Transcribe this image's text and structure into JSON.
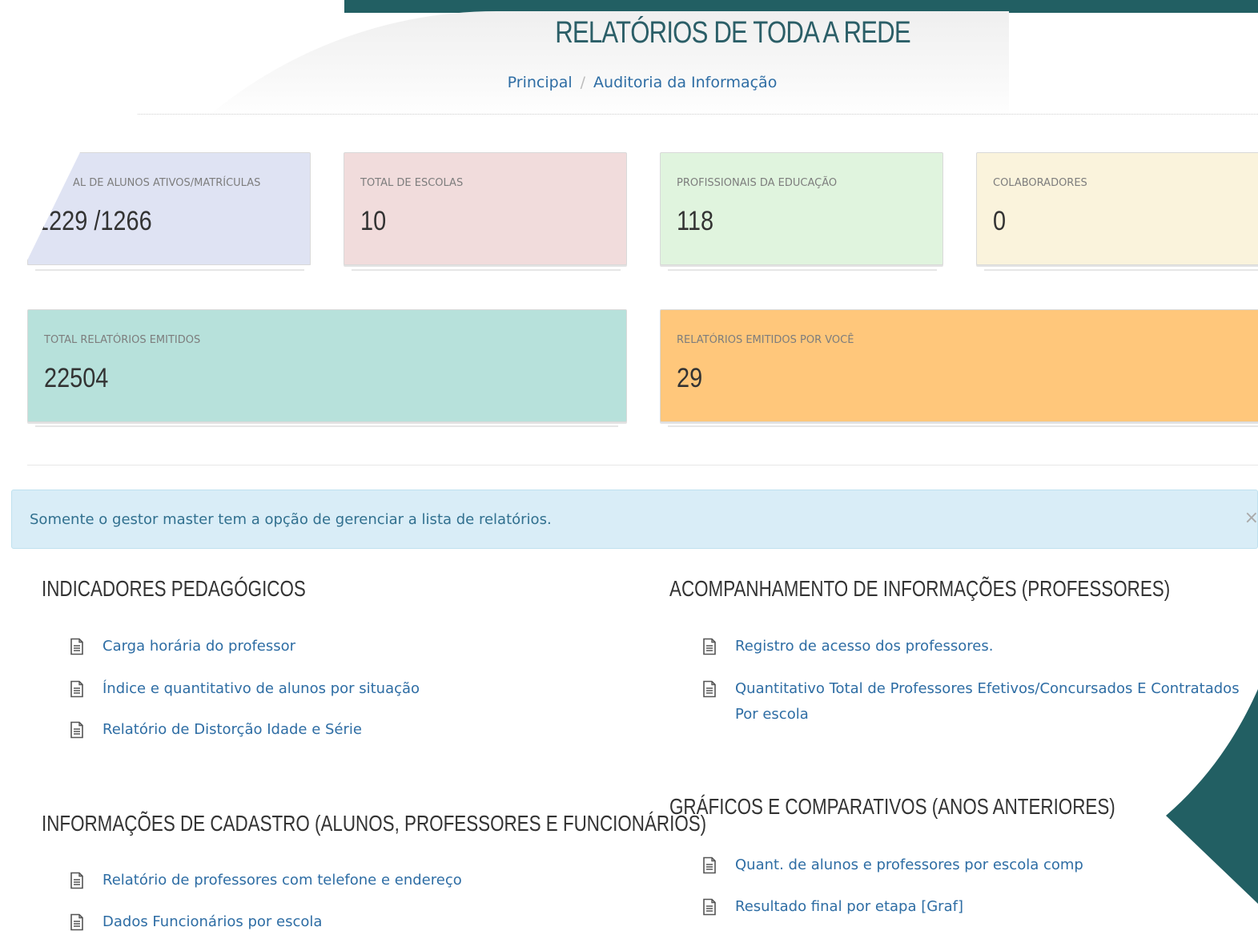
{
  "header": {
    "title": "RELATÓRIOS DE TODA A REDE",
    "breadcrumb": {
      "home": "Principal",
      "separator": "/",
      "current": "Auditoria da Informação"
    }
  },
  "stats": [
    {
      "label": "AL DE ALUNOS ATIVOS/MATRÍCULAS",
      "value": "1229 /1266",
      "color": "#dfe3f3"
    },
    {
      "label": "TOTAL DE ESCOLAS",
      "value": "10",
      "color": "#f1dcdc"
    },
    {
      "label": "PROFISSIONAIS DA EDUCAÇÃO",
      "value": "118",
      "color": "#e0f4de"
    },
    {
      "label": "COLABORADORES",
      "value": "0",
      "color": "#faf3dc"
    },
    {
      "label": "TOTAL RELATÓRIOS EMITIDOS",
      "value": "22504",
      "color": "#b7e1db"
    },
    {
      "label": "RELATÓRIOS EMITIDOS POR VOCÊ",
      "value": "29",
      "color": "#ffc77b"
    }
  ],
  "alert": {
    "message": "Somente o gestor master tem a opção de gerenciar a lista de relatórios.",
    "close": "×"
  },
  "sections": [
    {
      "title": "INDICADORES PEDAGÓGICOS",
      "items": [
        "Carga horária do professor",
        "Índice e quantitativo de alunos por situação",
        "Relatório de Distorção Idade e Série"
      ]
    },
    {
      "title": "ACOMPANHAMENTO DE INFORMAÇÕES (PROFESSORES)",
      "items": [
        "Registro de acesso dos professores.",
        "Quantitativo Total de Professores Efetivos/Concursados E Contratados Por escola"
      ]
    },
    {
      "title": "INFORMAÇÕES DE CADASTRO (ALUNOS, PROFESSORES E FUNCIONÁRIOS)",
      "items": [
        "Relatório de professores com telefone e endereço",
        "Dados Funcionários por escola"
      ]
    },
    {
      "title": "GRÁFICOS E COMPARATIVOS (ANOS ANTERIORES)",
      "items": [
        "Quant. de alunos e professores por escola comp",
        "Resultado final por etapa [Graf]"
      ]
    }
  ],
  "theme": {
    "accent": "#225f63",
    "link": "#2e6da4"
  },
  "icons": {
    "report": "document-icon",
    "close": "close-icon"
  }
}
